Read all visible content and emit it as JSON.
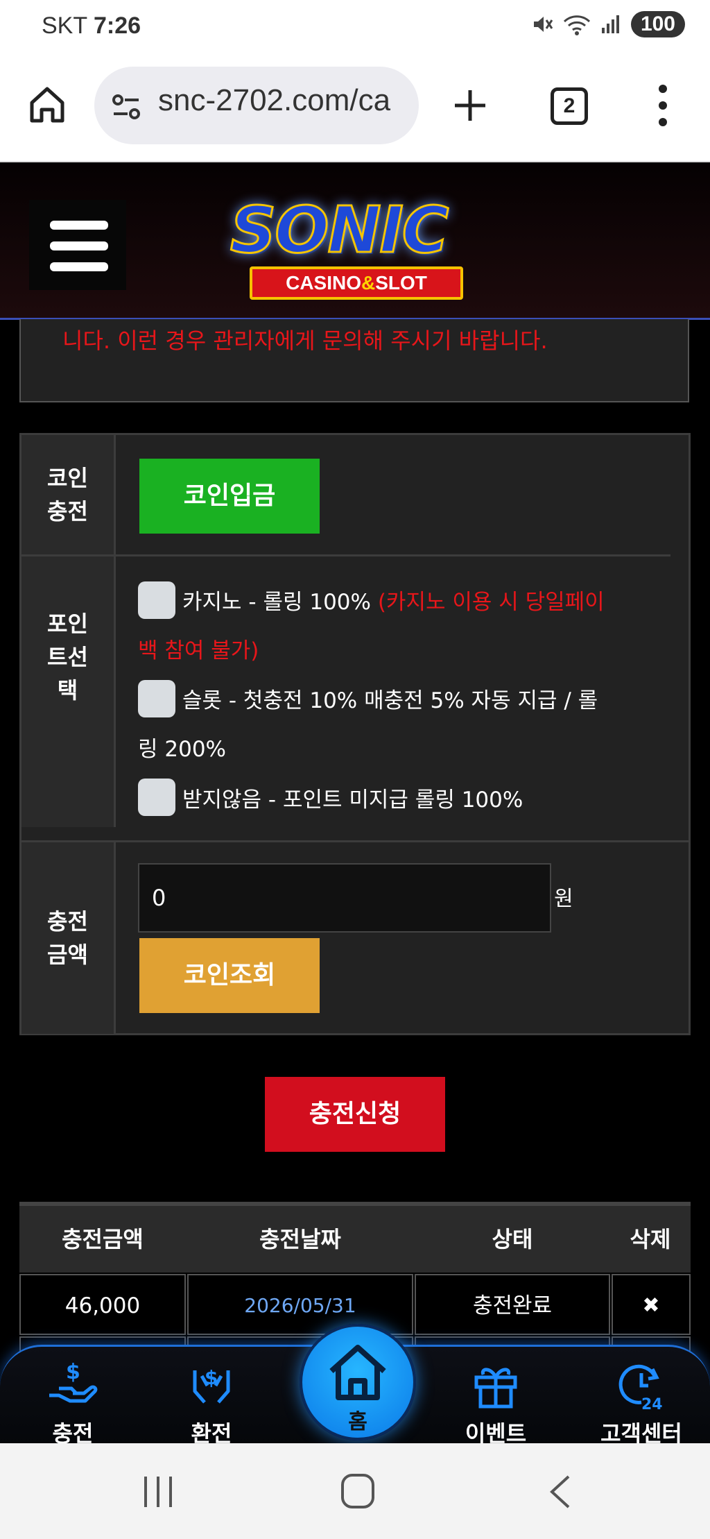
{
  "status_bar": {
    "carrier": "SKT",
    "time": "7:26",
    "battery": "100"
  },
  "browser": {
    "url": "snc-2702.com/ca",
    "tab_count": "2"
  },
  "site": {
    "logo_title": "SONIC",
    "logo_sub_left": "CASINO",
    "logo_sub_amp": "&",
    "logo_sub_right": "SLOT"
  },
  "notice": {
    "text": "니다. 이런 경우 관리자에게 문의해 주시기 바랍니다."
  },
  "form": {
    "coin_charge": {
      "label_line1": "코인",
      "label_line2": "충전",
      "button": "코인입금"
    },
    "point_select": {
      "label_line1": "포인",
      "label_line2": "트선",
      "label_line3": "택",
      "options": [
        {
          "text": "카지노 - 롤링 100% ",
          "note_line1": "(카지노 이용 시 당일페이",
          "note_line2": "백 참여 불가)",
          "checked": false
        },
        {
          "text_line1": "슬롯 - 첫충전 10% 매충전 5% 자동 지급 / 롤",
          "text_line2": "링 200%",
          "checked": false
        },
        {
          "text": "받지않음 - 포인트 미지급 롤링 100%",
          "checked": false
        }
      ]
    },
    "charge_amount": {
      "label_line1": "충전",
      "label_line2": "금액",
      "value": "0",
      "unit": "원",
      "button": "코인조회"
    }
  },
  "submit": {
    "label": "충전신청"
  },
  "history": {
    "headers": [
      "충전금액",
      "충전날짜",
      "상태",
      "삭제"
    ],
    "rows": [
      {
        "amount": "46,000",
        "date": "2026/05/31",
        "status": "충전완료",
        "delete": "✖"
      }
    ]
  },
  "bottom_nav": {
    "items": [
      {
        "label": "충전",
        "icon": "charge-icon"
      },
      {
        "label": "환전",
        "icon": "exchange-icon"
      },
      {
        "label": "홈",
        "icon": "home-icon"
      },
      {
        "label": "이벤트",
        "icon": "gift-icon"
      },
      {
        "label": "고객센터",
        "icon": "support-24-icon"
      }
    ]
  },
  "colors": {
    "accent_blue": "#1e6fd8",
    "green": "#1ab122",
    "gold": "#e0a133",
    "red": "#d20e1e",
    "warning_text": "#e8161a"
  }
}
